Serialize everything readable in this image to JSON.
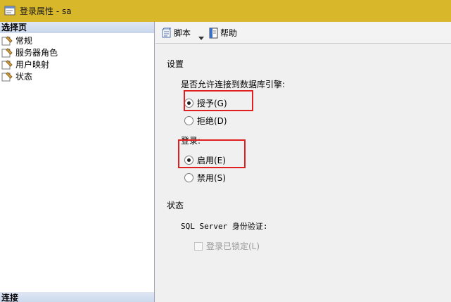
{
  "window": {
    "title": "登录属性 - sa"
  },
  "left_pane": {
    "header": "选择页",
    "pages": [
      {
        "label": "常规"
      },
      {
        "label": "服务器角色"
      },
      {
        "label": "用户映射"
      },
      {
        "label": "状态"
      }
    ],
    "footer": "连接"
  },
  "toolbar": {
    "script_label": "脚本",
    "help_label": "帮助"
  },
  "settings": {
    "section_title": "设置",
    "db_engine_question": "是否允许连接到数据库引擎:",
    "grant_label": "授予(G)",
    "grant_selected": true,
    "deny_label": "拒绝(D)",
    "deny_selected": false,
    "login_label": "登录:",
    "enabled_label": "启用(E)",
    "enabled_selected": true,
    "disabled_label": "禁用(S)",
    "disabled_selected": false
  },
  "status": {
    "section_title": "状态",
    "auth_label": "SQL Server 身份验证:",
    "locked_label": "登录已锁定(L)",
    "locked_checked": false,
    "locked_enabled": false
  },
  "colors": {
    "titlebar": "#d8b82a",
    "highlight_box": "#e02020"
  }
}
